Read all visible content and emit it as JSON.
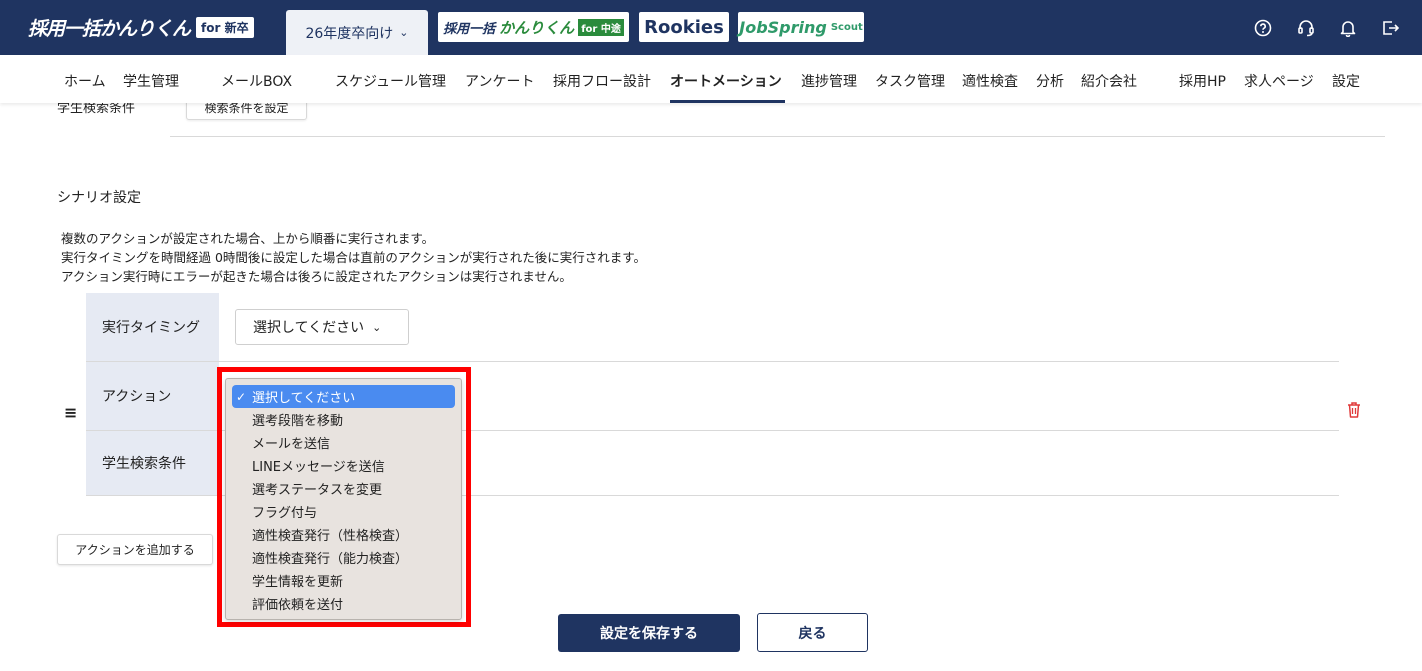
{
  "header": {
    "logo_text": "採用一括かんりくん",
    "logo_badge": "for 新卒",
    "year_select": "26年度卒向け",
    "ext_links": {
      "chuto_text1": "採用一括",
      "chuto_text2": "かんりくん",
      "chuto_badge": "for 中途",
      "rookies": "Rookies",
      "jobspring": "JobSpring",
      "jobspring_sub": "Scout"
    }
  },
  "nav": {
    "items": [
      "ホーム",
      "学生管理",
      "メールBOX",
      "スケジュール管理",
      "アンケート",
      "採用フロー設計",
      "オートメーション",
      "進捗管理",
      "タスク管理",
      "適性検査",
      "分析",
      "紹介会社",
      "採用HP",
      "求人ページ",
      "設定"
    ],
    "active": "オートメーション"
  },
  "top_partial": {
    "label": "学生検索条件",
    "button": "検索条件を設定"
  },
  "scenario": {
    "title": "シナリオ設定",
    "desc": [
      "複数のアクションが設定された場合、上から順番に実行されます。",
      "実行タイミングを時間経過 0時間後に設定した場合は直前のアクションが実行された後に実行されます。",
      "アクション実行時にエラーが起きた場合は後ろに設定されたアクションは実行されません。"
    ],
    "rows": {
      "timing_label": "実行タイミング",
      "timing_value": "選択してください",
      "action_label": "アクション",
      "search_label": "学生検索条件"
    },
    "add_action": "アクションを追加する"
  },
  "dropdown": {
    "selected": "選択してください",
    "options": [
      "選択してください",
      "選考段階を移動",
      "メールを送信",
      "LINEメッセージを送信",
      "選考ステータスを変更",
      "フラグ付与",
      "適性検査発行（性格検査）",
      "適性検査発行（能力検査）",
      "学生情報を更新",
      "評価依頼を送付"
    ]
  },
  "footer": {
    "save": "設定を保存する",
    "back": "戻る"
  },
  "colors": {
    "header_bg": "#1f3461",
    "highlight": "#ff0000",
    "selected_option": "#4a8bf0"
  }
}
